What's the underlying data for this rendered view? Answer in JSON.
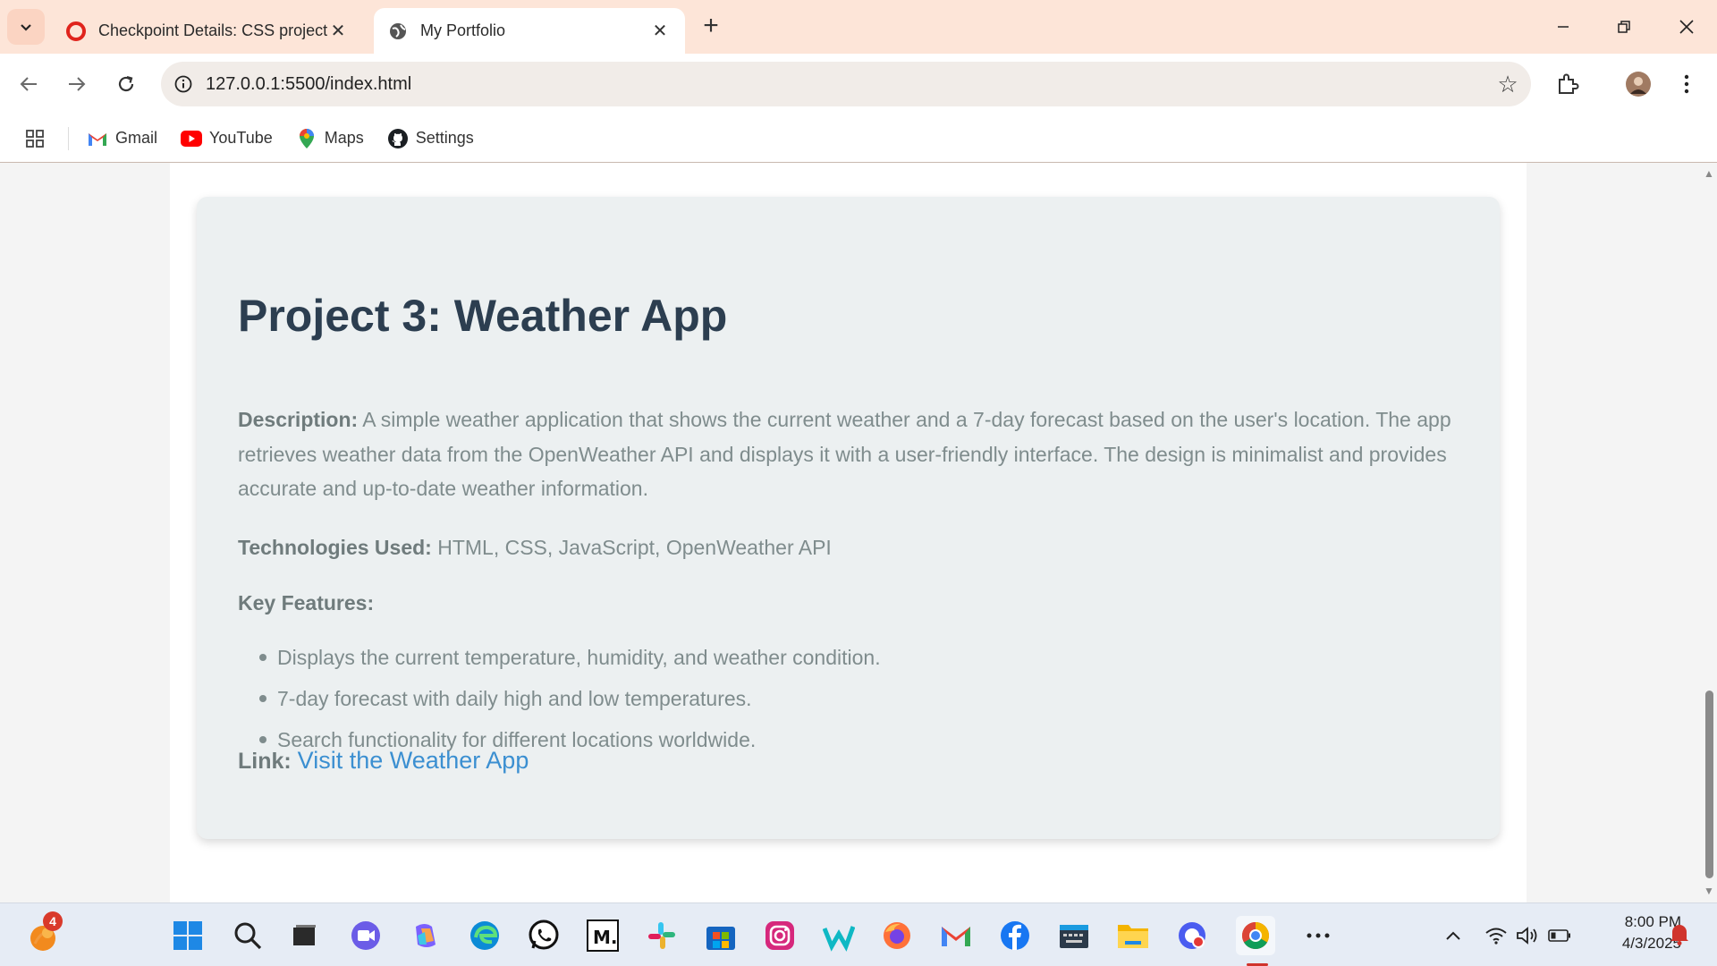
{
  "browser": {
    "tabs": [
      {
        "title": "Checkpoint Details: CSS project",
        "active": false
      },
      {
        "title": "My Portfolio",
        "active": true
      }
    ],
    "url": "127.0.0.1:5500/index.html",
    "bookmarks": [
      {
        "label": "Gmail",
        "icon": "gmail-icon"
      },
      {
        "label": "YouTube",
        "icon": "youtube-icon"
      },
      {
        "label": "Maps",
        "icon": "maps-icon"
      },
      {
        "label": "Settings",
        "icon": "github-icon"
      }
    ]
  },
  "project": {
    "title": "Project 3: Weather App",
    "description_label": "Description:",
    "description": " A simple weather application that shows the current weather and a 7-day forecast based on the user's location. The app retrieves weather data from the OpenWeather API and displays it with a user-friendly interface. The design is minimalist and provides accurate and up-to-date weather information.",
    "tech_label": "Technologies Used:",
    "tech": " HTML, CSS, JavaScript, OpenWeather API",
    "features_label": "Key Features:",
    "features": [
      "Displays the current temperature, humidity, and weather condition.",
      "7-day forecast with daily high and low temperatures.",
      "Search functionality for different locations worldwide."
    ],
    "link_label": "Link:",
    "link_text": "Visit the Weather App"
  },
  "taskbar": {
    "notification_count": "4",
    "time": "8:00 PM",
    "date": "4/3/2025"
  },
  "colors": {
    "chrome_bg": "#fde5d8",
    "card_bg": "#ecf0f1",
    "heading": "#2c3e50",
    "body_text": "#7f8c8d",
    "link": "#3b8fd1"
  }
}
